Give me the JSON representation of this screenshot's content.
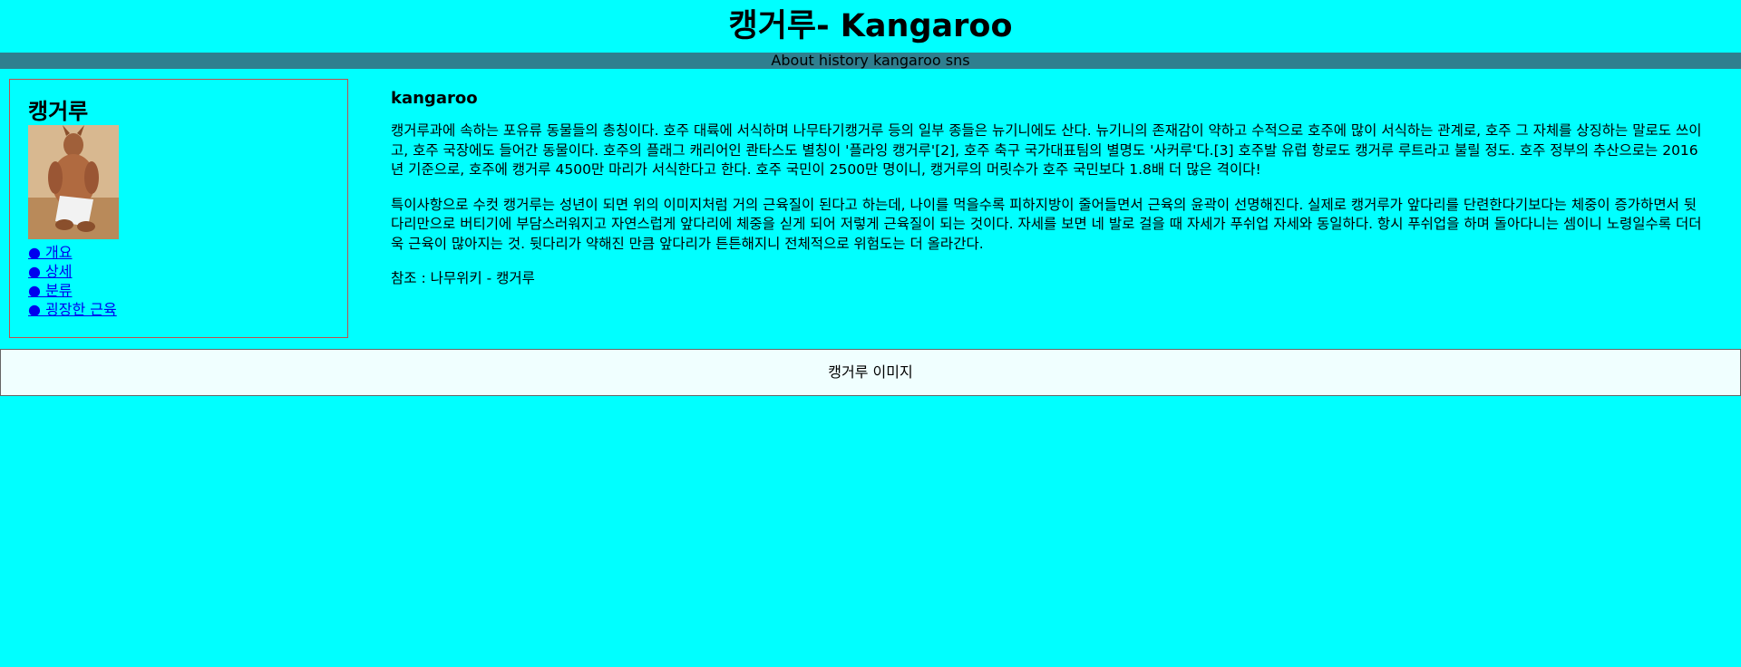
{
  "header": {
    "title": "캥거루- Kangaroo"
  },
  "navbar": {
    "items": [
      "About",
      "history",
      "kangaroo",
      "sns"
    ]
  },
  "sidebar": {
    "title": "캥거루",
    "image_alt": "kangaroo",
    "links": [
      "● 개요",
      "● 상세",
      "● 분류",
      "● 굉장한 근육"
    ]
  },
  "main": {
    "heading": "kangaroo",
    "paragraph1": "캥거루과에 속하는 포유류 동물들의 총칭이다. 호주 대륙에 서식하며 나무타기캥거루 등의 일부 종들은 뉴기니에도 산다. 뉴기니의 존재감이 약하고 수적으로 호주에 많이 서식하는 관계로, 호주 그 자체를 상징하는 말로도 쓰이고, 호주 국장에도 들어간 동물이다. 호주의 플래그 캐리어인 콴타스도 별칭이 '플라잉 캥거루'[2], 호주 축구 국가대표팀의 별명도 '사커루'다.[3] 호주발 유럽 항로도 캥거루 루트라고 불릴 정도. 호주 정부의 추산으로는 2016년 기준으로, 호주에 캥거루 4500만 마리가 서식한다고 한다. 호주 국민이 2500만 명이니, 캥거루의 머릿수가 호주 국민보다 1.8배 더 많은 격이다!",
    "paragraph2": "특이사항으로 수컷 캥거루는 성년이 되면 위의 이미지처럼 거의 근육질이 된다고 하는데, 나이를 먹을수록 피하지방이 줄어들면서 근육의 윤곽이 선명해진다. 실제로 캥거루가 앞다리를 단련한다기보다는 체중이 증가하면서 뒷다리만으로 버티기에 부담스러워지고 자연스럽게 앞다리에 체중을 싣게 되어 저렇게 근육질이 되는 것이다. 자세를 보면 네 발로 걸을 때 자세가 푸쉬업 자세와 동일하다. 항시 푸쉬업을 하며 돌아다니는 셈이니 노령일수록 더더욱 근육이 많아지는 것. 뒷다리가 약해진 만큼 앞다리가 튼튼해지니 전체적으로 위험도는 더 올라간다.",
    "reference": "참조 : 나무위키 - 캥거루"
  },
  "footer": {
    "label": "캥거루 이미지"
  }
}
